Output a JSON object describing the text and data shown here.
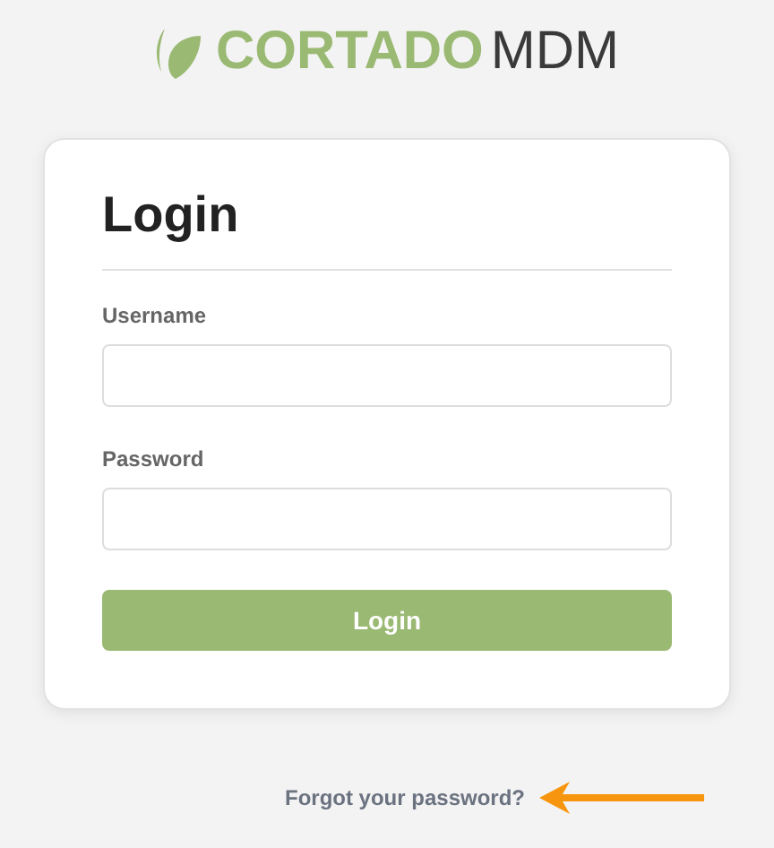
{
  "logo": {
    "brand": "CORTADO",
    "product": "MDM"
  },
  "form": {
    "title": "Login",
    "fields": [
      {
        "label": "Username"
      },
      {
        "label": "Password"
      }
    ],
    "button": "Login"
  },
  "forgot_link": "Forgot your password?"
}
